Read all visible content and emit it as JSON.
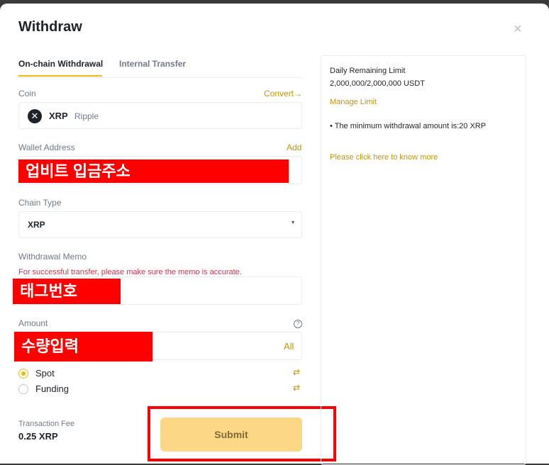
{
  "dialog": {
    "title": "Withdraw",
    "close_icon": "×"
  },
  "tabs": [
    {
      "label": "On-chain Withdrawal",
      "active": true
    },
    {
      "label": "Internal Transfer",
      "active": false
    }
  ],
  "coin": {
    "label": "Coin",
    "convert_link": "Convert→",
    "icon": "✕",
    "symbol": "XRP",
    "name": "Ripple"
  },
  "wallet": {
    "label": "Wallet Address",
    "add_link": "Add",
    "annotation": "업비트 입금주소"
  },
  "chain": {
    "label": "Chain Type",
    "value": "XRP",
    "caret": "▾"
  },
  "memo": {
    "label": "Withdrawal Memo",
    "warning": "For successful transfer, please make sure the memo is accurate.",
    "annotation": "태그번호"
  },
  "amount": {
    "label": "Amount",
    "help_icon": "?",
    "annotation": "수량입력",
    "all_button": "All"
  },
  "wallet_options": [
    {
      "label": "Spot",
      "selected": true,
      "swap_icon": "⇄"
    },
    {
      "label": "Funding",
      "selected": false,
      "swap_icon": "⇄"
    }
  ],
  "fee": {
    "label": "Transaction Fee",
    "value": "0.25 XRP"
  },
  "submit": {
    "label": "Submit"
  },
  "sidebar": {
    "limit_title": "Daily Remaining Limit",
    "limit_value": "2,000,000/2,000,000 USDT",
    "manage_link": "Manage Limit",
    "min_note": "• The minimum withdrawal amount is:20 XRP",
    "help_link": "Please click here to know more"
  },
  "colors": {
    "accent": "#f0b90b",
    "link": "#c99400",
    "warning": "#d9304e",
    "annotation_red": "#ff0000"
  }
}
